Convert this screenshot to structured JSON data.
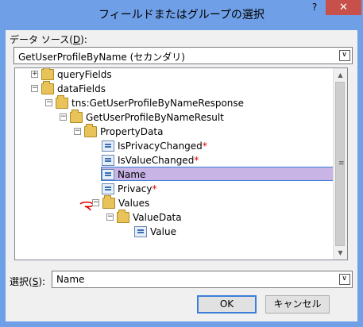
{
  "window": {
    "title": "フィールドまたはグループの選択",
    "help_label": "?",
    "close_label": "✕"
  },
  "datasource": {
    "label_prefix": "データ ソース(",
    "label_key": "D",
    "label_suffix": "):",
    "value": "GetUserProfileByName (セカンダリ)"
  },
  "tree": {
    "nodes": [
      {
        "name": "queryFields",
        "expander": "+"
      },
      {
        "name": "dataFields",
        "expander": "−"
      },
      {
        "name": "tns:GetUserProfileByNameResponse",
        "expander": "−"
      },
      {
        "name": "GetUserProfileByNameResult",
        "expander": "−"
      },
      {
        "name": "PropertyData",
        "expander": "−"
      },
      {
        "name": "IsPrivacyChanged",
        "required": "*"
      },
      {
        "name": "IsValueChanged",
        "required": "*"
      },
      {
        "name": "Name"
      },
      {
        "name": "Privacy",
        "required": "*"
      },
      {
        "name": "Values",
        "expander": "−"
      },
      {
        "name": "ValueData",
        "expander": "−"
      },
      {
        "name": "Value"
      }
    ]
  },
  "selection": {
    "label_prefix": "選択(",
    "label_key": "S",
    "label_suffix": "):",
    "value": "Name"
  },
  "buttons": {
    "ok_label": "OK",
    "cancel_label": "キャンセル"
  },
  "colors": {
    "accent": "#3c7fd9",
    "selected_bg": "#c9b4e6",
    "required": "#e00000",
    "titlebar": "#6f9fe6",
    "close": "#c7504b"
  }
}
